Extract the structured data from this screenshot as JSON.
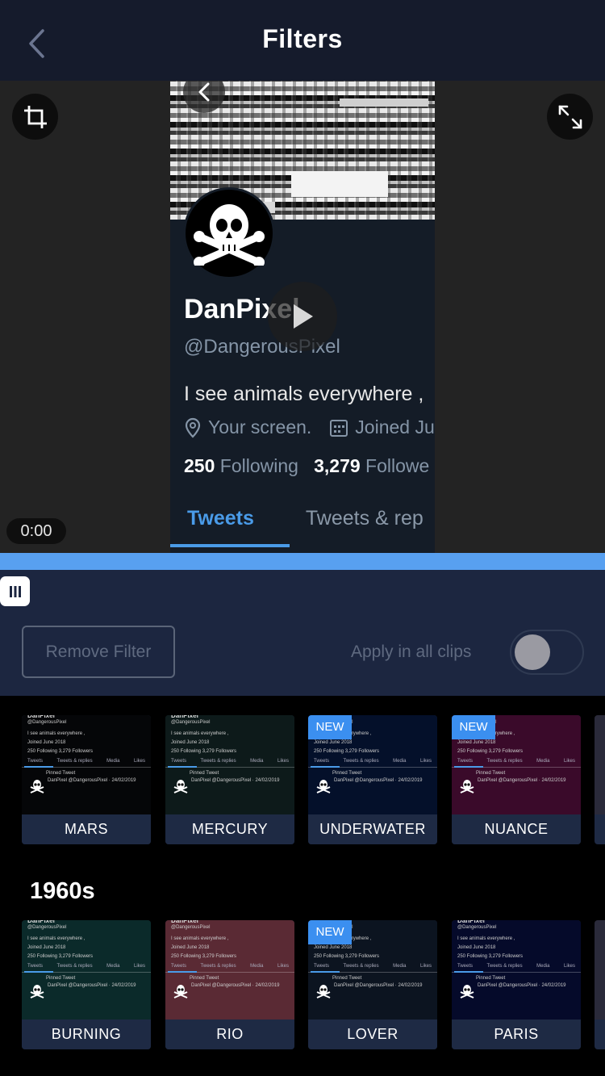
{
  "header": {
    "title": "Filters"
  },
  "preview": {
    "profile_name": "DanPixel",
    "handle": "@DangerousPixel",
    "bio": "I see animals everywhere ,",
    "location": "Your screen.",
    "joined": "Joined Ju",
    "following_count": "250",
    "following_label": "Following",
    "followers_count": "3,279",
    "followers_label": "Followe",
    "tab_active": "Tweets",
    "tab_inactive": "Tweets & rep",
    "time": "0:00"
  },
  "timeline": {
    "remove_filter_label": "Remove Filter",
    "apply_all_label": "Apply in all clips",
    "apply_all_on": false
  },
  "thumb": {
    "name": "DanPixel",
    "handle": "@DangerousPixel",
    "bio": "I see animals everywhere ,",
    "location": "Your screen.",
    "joined": "Joined June 2018",
    "stats": "250 Following  3,279 Followers",
    "tabs": [
      "Tweets",
      "Tweets & replies",
      "Media",
      "Likes"
    ],
    "pinned": "Pinned Tweet",
    "tweet_author": "DanPixel @DangerousPixel · 24/02/2019"
  },
  "sections": [
    {
      "title": "",
      "filters": [
        {
          "label": "MARS",
          "is_new": false,
          "tint": "#050608"
        },
        {
          "label": "MERCURY",
          "is_new": false,
          "tint": "#0d1a1a"
        },
        {
          "label": "UNDERWATER",
          "is_new": true,
          "tint": "#04102a"
        },
        {
          "label": "NUANCE",
          "is_new": true,
          "tint": "#3a0a2a"
        }
      ]
    },
    {
      "title": "1960s",
      "filters": [
        {
          "label": "BURNING",
          "is_new": false,
          "tint": "#0b2a2a"
        },
        {
          "label": "RIO",
          "is_new": false,
          "tint": "#5a2a34"
        },
        {
          "label": "LOVER",
          "is_new": true,
          "tint": "#0c1420"
        },
        {
          "label": "PARIS",
          "is_new": false,
          "tint": "#050a2a"
        }
      ]
    }
  ],
  "new_badge_label": "NEW"
}
